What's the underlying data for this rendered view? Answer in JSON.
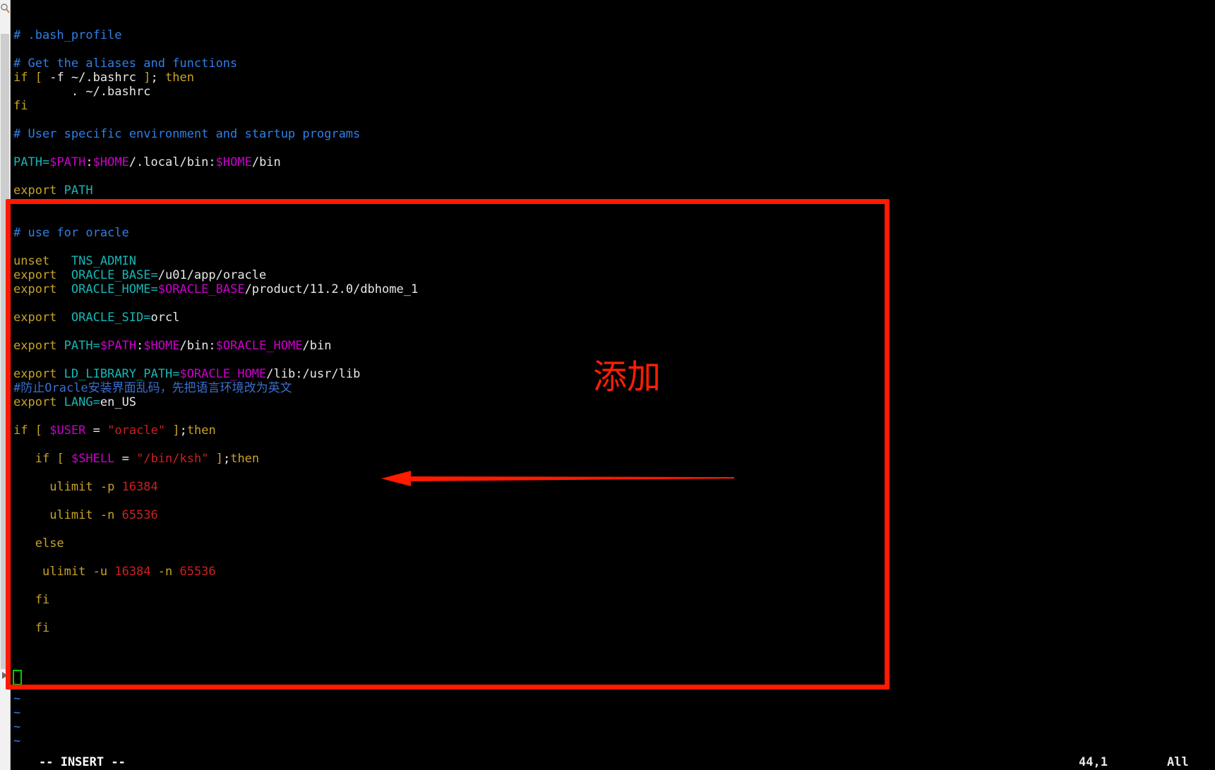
{
  "window": {
    "app": "terminal-vim",
    "background_color": "#000000",
    "gutter_color": "#f1f1f1",
    "magnifier_icon": "magnifier-icon",
    "scroll_arrow_icon": "scroll-arrow-icon"
  },
  "editor": {
    "filename_comment": "# .bash_profile",
    "lines": [
      {
        "i": 0,
        "segs": [
          {
            "t": "# .bash_profile",
            "c": "c-comment"
          }
        ]
      },
      {
        "i": 1,
        "segs": []
      },
      {
        "i": 2,
        "segs": [
          {
            "t": "# Get the aliases and functions",
            "c": "c-comment"
          }
        ]
      },
      {
        "i": 3,
        "segs": [
          {
            "t": "if",
            "c": "c-keyword"
          },
          {
            "t": " ",
            "c": "c-plain"
          },
          {
            "t": "[",
            "c": "c-keyword"
          },
          {
            "t": " -f ~/.bashrc ",
            "c": "c-plain"
          },
          {
            "t": "]",
            "c": "c-keyword"
          },
          {
            "t": "; ",
            "c": "c-plain"
          },
          {
            "t": "then",
            "c": "c-keyword"
          }
        ]
      },
      {
        "i": 4,
        "segs": [
          {
            "t": "        . ~/.bashrc",
            "c": "c-plain"
          }
        ]
      },
      {
        "i": 5,
        "segs": [
          {
            "t": "fi",
            "c": "c-keyword"
          }
        ]
      },
      {
        "i": 6,
        "segs": []
      },
      {
        "i": 7,
        "segs": [
          {
            "t": "# User specific environment and startup programs",
            "c": "c-comment"
          }
        ]
      },
      {
        "i": 8,
        "segs": []
      },
      {
        "i": 9,
        "segs": [
          {
            "t": "PATH=",
            "c": "c-ident"
          },
          {
            "t": "$PATH",
            "c": "c-var"
          },
          {
            "t": ":",
            "c": "c-plain"
          },
          {
            "t": "$HOME",
            "c": "c-var"
          },
          {
            "t": "/.local/bin:",
            "c": "c-plain"
          },
          {
            "t": "$HOME",
            "c": "c-var"
          },
          {
            "t": "/bin",
            "c": "c-plain"
          }
        ]
      },
      {
        "i": 10,
        "segs": []
      },
      {
        "i": 11,
        "segs": [
          {
            "t": "export",
            "c": "c-keyword"
          },
          {
            "t": " ",
            "c": "c-plain"
          },
          {
            "t": "PATH",
            "c": "c-ident"
          }
        ]
      },
      {
        "i": 12,
        "segs": []
      },
      {
        "i": 13,
        "segs": []
      },
      {
        "i": 14,
        "segs": [
          {
            "t": "# use for oracle",
            "c": "c-comment"
          }
        ]
      },
      {
        "i": 15,
        "segs": []
      },
      {
        "i": 16,
        "segs": [
          {
            "t": "unset",
            "c": "c-keyword"
          },
          {
            "t": "   ",
            "c": "c-plain"
          },
          {
            "t": "TNS_ADMIN",
            "c": "c-ident"
          }
        ]
      },
      {
        "i": 17,
        "segs": [
          {
            "t": "export",
            "c": "c-keyword"
          },
          {
            "t": "  ",
            "c": "c-plain"
          },
          {
            "t": "ORACLE_BASE=",
            "c": "c-ident"
          },
          {
            "t": "/u01/app/oracle",
            "c": "c-plain"
          }
        ]
      },
      {
        "i": 18,
        "segs": [
          {
            "t": "export",
            "c": "c-keyword"
          },
          {
            "t": "  ",
            "c": "c-plain"
          },
          {
            "t": "ORACLE_HOME=",
            "c": "c-ident"
          },
          {
            "t": "$ORACLE_BASE",
            "c": "c-var"
          },
          {
            "t": "/product/11.2.0/dbhome_1",
            "c": "c-plain"
          }
        ]
      },
      {
        "i": 19,
        "segs": []
      },
      {
        "i": 20,
        "segs": [
          {
            "t": "export",
            "c": "c-keyword"
          },
          {
            "t": "  ",
            "c": "c-plain"
          },
          {
            "t": "ORACLE_SID=",
            "c": "c-ident"
          },
          {
            "t": "orcl",
            "c": "c-plain"
          }
        ]
      },
      {
        "i": 21,
        "segs": []
      },
      {
        "i": 22,
        "segs": [
          {
            "t": "export",
            "c": "c-keyword"
          },
          {
            "t": " ",
            "c": "c-plain"
          },
          {
            "t": "PATH=",
            "c": "c-ident"
          },
          {
            "t": "$PATH",
            "c": "c-var"
          },
          {
            "t": ":",
            "c": "c-plain"
          },
          {
            "t": "$HOME",
            "c": "c-var"
          },
          {
            "t": "/bin:",
            "c": "c-plain"
          },
          {
            "t": "$ORACLE_HOME",
            "c": "c-var"
          },
          {
            "t": "/bin",
            "c": "c-plain"
          }
        ]
      },
      {
        "i": 23,
        "segs": []
      },
      {
        "i": 24,
        "segs": [
          {
            "t": "export",
            "c": "c-keyword"
          },
          {
            "t": " ",
            "c": "c-plain"
          },
          {
            "t": "LD_LIBRARY_PATH=",
            "c": "c-ident"
          },
          {
            "t": "$ORACLE_HOME",
            "c": "c-var"
          },
          {
            "t": "/lib:/usr/lib",
            "c": "c-plain"
          }
        ]
      },
      {
        "i": 25,
        "segs": [
          {
            "t": "#防止Oracle安装界面乱码，先把语言环境改为英文",
            "c": "c-cn"
          }
        ]
      },
      {
        "i": 26,
        "segs": [
          {
            "t": "export",
            "c": "c-keyword"
          },
          {
            "t": " ",
            "c": "c-plain"
          },
          {
            "t": "LANG=",
            "c": "c-ident"
          },
          {
            "t": "en_US",
            "c": "c-plain"
          }
        ]
      },
      {
        "i": 27,
        "segs": []
      },
      {
        "i": 28,
        "segs": [
          {
            "t": "if",
            "c": "c-keyword"
          },
          {
            "t": " ",
            "c": "c-plain"
          },
          {
            "t": "[",
            "c": "c-keyword"
          },
          {
            "t": " ",
            "c": "c-plain"
          },
          {
            "t": "$USER",
            "c": "c-var"
          },
          {
            "t": " ",
            "c": "c-plain"
          },
          {
            "t": "=",
            "c": "c-plain"
          },
          {
            "t": " ",
            "c": "c-plain"
          },
          {
            "t": "\"oracle\"",
            "c": "c-string"
          },
          {
            "t": " ",
            "c": "c-plain"
          },
          {
            "t": "]",
            "c": "c-keyword"
          },
          {
            "t": ";",
            "c": "c-plain"
          },
          {
            "t": "then",
            "c": "c-keyword"
          }
        ]
      },
      {
        "i": 29,
        "segs": []
      },
      {
        "i": 30,
        "segs": [
          {
            "t": "   ",
            "c": "c-plain"
          },
          {
            "t": "if",
            "c": "c-keyword"
          },
          {
            "t": " ",
            "c": "c-plain"
          },
          {
            "t": "[",
            "c": "c-keyword"
          },
          {
            "t": " ",
            "c": "c-plain"
          },
          {
            "t": "$SHELL",
            "c": "c-var"
          },
          {
            "t": " = ",
            "c": "c-plain"
          },
          {
            "t": "\"/bin/ksh\"",
            "c": "c-string"
          },
          {
            "t": " ",
            "c": "c-plain"
          },
          {
            "t": "]",
            "c": "c-keyword"
          },
          {
            "t": ";",
            "c": "c-plain"
          },
          {
            "t": "then",
            "c": "c-keyword"
          }
        ]
      },
      {
        "i": 31,
        "segs": []
      },
      {
        "i": 32,
        "segs": [
          {
            "t": "     ",
            "c": "c-plain"
          },
          {
            "t": "ulimit",
            "c": "c-keyword"
          },
          {
            "t": " -p ",
            "c": "c-keyword"
          },
          {
            "t": "16384",
            "c": "c-number"
          }
        ]
      },
      {
        "i": 33,
        "segs": []
      },
      {
        "i": 34,
        "segs": [
          {
            "t": "     ",
            "c": "c-plain"
          },
          {
            "t": "ulimit",
            "c": "c-keyword"
          },
          {
            "t": " -n ",
            "c": "c-keyword"
          },
          {
            "t": "65536",
            "c": "c-number"
          }
        ]
      },
      {
        "i": 35,
        "segs": []
      },
      {
        "i": 36,
        "segs": [
          {
            "t": "   ",
            "c": "c-plain"
          },
          {
            "t": "else",
            "c": "c-keyword"
          }
        ]
      },
      {
        "i": 37,
        "segs": []
      },
      {
        "i": 38,
        "segs": [
          {
            "t": "    ",
            "c": "c-plain"
          },
          {
            "t": "ulimit",
            "c": "c-keyword"
          },
          {
            "t": " -u ",
            "c": "c-keyword"
          },
          {
            "t": "16384",
            "c": "c-number"
          },
          {
            "t": " -n ",
            "c": "c-keyword"
          },
          {
            "t": "65536",
            "c": "c-number"
          }
        ]
      },
      {
        "i": 39,
        "segs": []
      },
      {
        "i": 40,
        "segs": [
          {
            "t": "   ",
            "c": "c-plain"
          },
          {
            "t": "fi",
            "c": "c-keyword"
          }
        ]
      },
      {
        "i": 41,
        "segs": []
      },
      {
        "i": 42,
        "segs": [
          {
            "t": "   ",
            "c": "c-plain"
          },
          {
            "t": "fi",
            "c": "c-keyword"
          }
        ]
      },
      {
        "i": 43,
        "segs": []
      }
    ],
    "filler_lines": [
      "~",
      "~",
      "~",
      "~",
      "~"
    ],
    "cursor": {
      "line": 44,
      "col": 1
    }
  },
  "status": {
    "mode": "-- INSERT --",
    "position": "44,1",
    "scroll": "All"
  },
  "annotations": {
    "box_color": "#ff1a00",
    "label": "添加",
    "label_color": "#fa1e05",
    "arrow_color": "#ff1a00",
    "arrow_direction": "left"
  }
}
